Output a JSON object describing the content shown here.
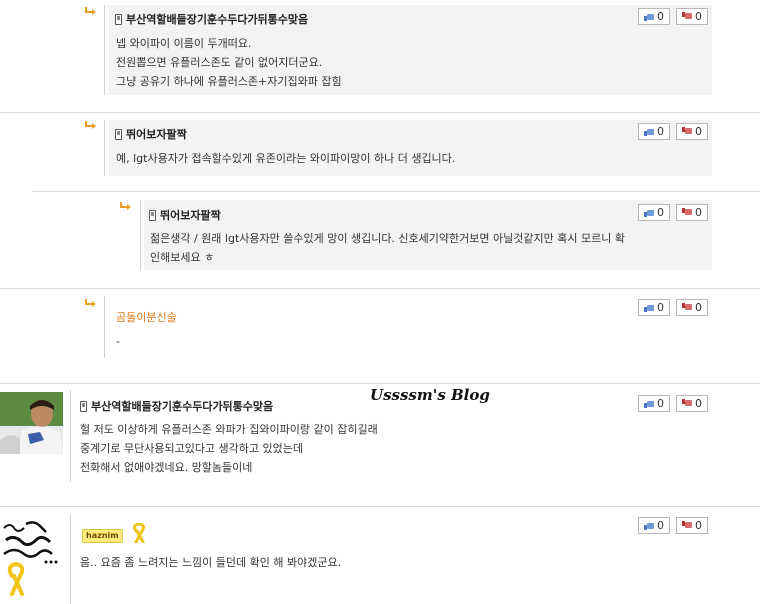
{
  "comments": [
    {
      "author": "부산역할배들장기훈수두다가뒤통수맞음",
      "lines": [
        "넵 와이파이 이름이 두개떠요.",
        "전원뽑으면 유플러스존도 같이 없어지더군요.",
        "그냥 공유기 하나에 유플러스존+자기집와파 잡힘"
      ],
      "up": "0",
      "down": "0"
    },
    {
      "author": "뛰어보자팔짝",
      "lines": [
        "예, lgt사용자가 접속할수있게 유존이라는 와이파이망이 하나 더 생깁니다."
      ],
      "up": "0",
      "down": "0"
    },
    {
      "author": "뛰어보자팔짝",
      "lines": [
        "젊은생각 / 원래 lgt사용자만 쓸수있게 망이 생깁니다. 신호세기약한거보면 아닐것같지만 혹시 모르니 확",
        "인해보세요 ㅎ"
      ],
      "up": "0",
      "down": "0"
    },
    {
      "author": "곰돌이분신술",
      "lines": [
        "-"
      ],
      "up": "0",
      "down": "0"
    },
    {
      "author": "부산역할배들장기훈수두다가뒤통수맞음",
      "lines": [
        "헐 저도 이상하게 유플러스존 와파가 집와이파이랑 같이 잡히길래",
        "중계기로 무단사용되고있다고 생각하고 있었는데",
        "전화해서 없애야겠네요. 망할놈들이네"
      ],
      "up": "0",
      "down": "0"
    },
    {
      "author_badge": "haznim",
      "lines": [
        "음.. 요즘 좀 느려지는 느낌이 들던데 확인 해 봐야겠군요."
      ],
      "up": "0",
      "down": "0"
    }
  ],
  "watermark": "Ussssm's Blog",
  "icons": {
    "reply": "reply-arrow-icon",
    "phone": "mobile-phone-icon",
    "up": "thumb-up-icon",
    "down": "thumb-down-icon",
    "ribbon": "yellow-ribbon-icon"
  },
  "colors": {
    "reply_arrow": "#e8a020",
    "nickname_orange": "#e07a1e",
    "reply_box": "#f3f3f3",
    "separator": "#d9d9d9"
  }
}
